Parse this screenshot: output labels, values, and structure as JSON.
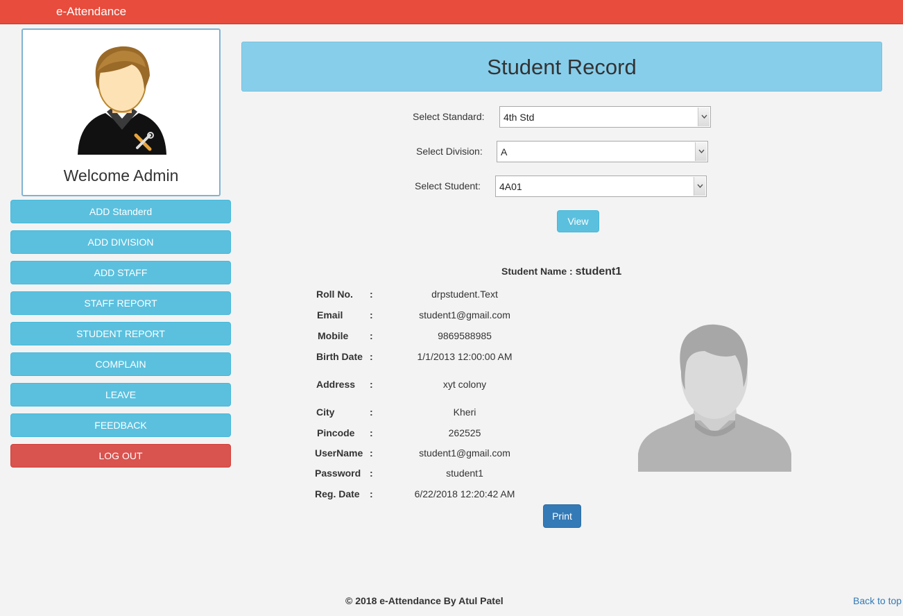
{
  "header": {
    "brand": "e-Attendance"
  },
  "profile": {
    "welcome": "Welcome Admin",
    "avatar_icon": "admin-avatar-icon"
  },
  "sidebar": {
    "items": [
      {
        "label": "ADD Standerd"
      },
      {
        "label": "ADD DIVISION"
      },
      {
        "label": "ADD STAFF"
      },
      {
        "label": "STAFF REPORT"
      },
      {
        "label": "STUDENT REPORT"
      },
      {
        "label": "COMPLAIN"
      },
      {
        "label": "LEAVE"
      },
      {
        "label": "FEEDBACK"
      }
    ],
    "logout": "LOG OUT"
  },
  "main": {
    "title": "Student Record",
    "form": {
      "standard_label": "Select Standard:",
      "standard_value": "4th Std",
      "division_label": "Select Division:",
      "division_value": "A",
      "student_label": "Select Student:",
      "student_value": "4A01",
      "view_button": "View"
    },
    "student": {
      "name_label": "Student Name :",
      "name": "student1",
      "colon": ":",
      "fields": [
        {
          "label": "Roll No.",
          "value": "drpstudent.Text"
        },
        {
          "label": "Email",
          "value": "student1@gmail.com"
        },
        {
          "label": "Mobile",
          "value": "9869588985"
        },
        {
          "label": "Birth Date",
          "value": "1/1/2013 12:00:00 AM"
        },
        {
          "label": "Address",
          "value": "xyt colony"
        },
        {
          "label": "City",
          "value": "Kheri"
        },
        {
          "label": "Pincode",
          "value": "262525"
        },
        {
          "label": "UserName",
          "value": "student1@gmail.com"
        },
        {
          "label": "Password",
          "value": "student1"
        },
        {
          "label": "Reg. Date",
          "value": "6/22/2018 12:20:42 AM"
        }
      ],
      "photo_icon": "student-photo-placeholder",
      "print_button": "Print"
    }
  },
  "footer": {
    "copyright": "© 2018 e-Attendance By Atul Patel",
    "back_to_top": "Back to top"
  },
  "colors": {
    "topbar": "#e74c3c",
    "info": "#5bc0de",
    "danger": "#d9534f",
    "primary": "#337ab7",
    "heading": "#87ceeb"
  }
}
